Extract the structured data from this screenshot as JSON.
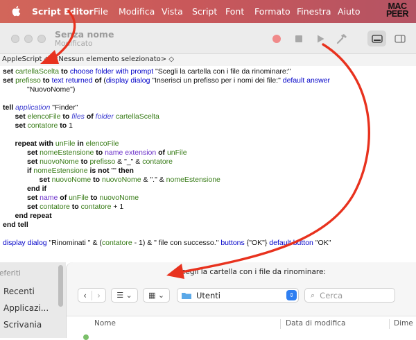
{
  "menubar": {
    "app": "Script Editor",
    "items": [
      "File",
      "Modifica",
      "Vista",
      "Script",
      "Font",
      "Formato",
      "Finestra",
      "Aiuto"
    ],
    "logo_line1": "MAC",
    "logo_line2": "PEER"
  },
  "window": {
    "title": "Senza nome",
    "subtitle": "Modificato"
  },
  "navbar": {
    "language": "AppleScript",
    "selection": "<Nessun elemento selezionato>"
  },
  "code": [
    [
      [
        "kw",
        "set "
      ],
      [
        "var",
        "cartellaScelta"
      ],
      [
        "kw",
        " to "
      ],
      [
        "cmd",
        "choose folder"
      ],
      [
        "cmd",
        " with prompt"
      ],
      [
        "str",
        " \"Scegli la cartella con i file da rinominare:\""
      ]
    ],
    [
      [
        "kw",
        "set "
      ],
      [
        "var",
        "prefisso"
      ],
      [
        "kw",
        " to "
      ],
      [
        "cmd",
        "text returned"
      ],
      [
        "kw",
        " of "
      ],
      [
        "op",
        "("
      ],
      [
        "cmd",
        "display dialog"
      ],
      [
        "str",
        " \"Inserisci un prefisso per i nomi dei file:\" "
      ],
      [
        "cmd",
        "default answer"
      ]
    ],
    [
      [
        "str",
        "            \"NuovoNome\")"
      ]
    ],
    [],
    [
      [
        "kw",
        "tell "
      ],
      [
        "cls",
        "application"
      ],
      [
        "str",
        " \"Finder\""
      ]
    ],
    [
      [
        "op",
        "      "
      ],
      [
        "kw",
        "set "
      ],
      [
        "var",
        "elencoFile"
      ],
      [
        "kw",
        " to "
      ],
      [
        "cls",
        "files"
      ],
      [
        "kw",
        " of "
      ],
      [
        "cls",
        "folder"
      ],
      [
        "var",
        " cartellaScelta"
      ]
    ],
    [
      [
        "op",
        "      "
      ],
      [
        "kw",
        "set "
      ],
      [
        "var",
        "contatore"
      ],
      [
        "kw",
        " to "
      ],
      [
        "op",
        "1"
      ]
    ],
    [],
    [
      [
        "op",
        "      "
      ],
      [
        "kw",
        "repeat with "
      ],
      [
        "var",
        "unFile"
      ],
      [
        "kw",
        " in "
      ],
      [
        "var",
        "elencoFile"
      ]
    ],
    [
      [
        "op",
        "            "
      ],
      [
        "kw",
        "set "
      ],
      [
        "var",
        "nomeEstensione"
      ],
      [
        "kw",
        " to "
      ],
      [
        "prop",
        "name extension"
      ],
      [
        "kw",
        " of "
      ],
      [
        "var",
        "unFile"
      ]
    ],
    [
      [
        "op",
        "            "
      ],
      [
        "kw",
        "set "
      ],
      [
        "var",
        "nuovoNome"
      ],
      [
        "kw",
        " to "
      ],
      [
        "var",
        "prefisso"
      ],
      [
        "op",
        " & \"_\" & "
      ],
      [
        "var",
        "contatore"
      ]
    ],
    [
      [
        "op",
        "            "
      ],
      [
        "kw",
        "if "
      ],
      [
        "var",
        "nomeEstensione"
      ],
      [
        "kw",
        " is not "
      ],
      [
        "op",
        "\"\" "
      ],
      [
        "kw",
        "then"
      ]
    ],
    [
      [
        "op",
        "                  "
      ],
      [
        "kw",
        "set "
      ],
      [
        "var",
        "nuovoNome"
      ],
      [
        "kw",
        " to "
      ],
      [
        "var",
        "nuovoNome"
      ],
      [
        "op",
        " & \".\" & "
      ],
      [
        "var",
        "nomeEstensione"
      ]
    ],
    [
      [
        "op",
        "            "
      ],
      [
        "kw",
        "end if"
      ]
    ],
    [
      [
        "op",
        "            "
      ],
      [
        "kw",
        "set "
      ],
      [
        "prop",
        "name"
      ],
      [
        "kw",
        " of "
      ],
      [
        "var",
        "unFile"
      ],
      [
        "kw",
        " to "
      ],
      [
        "var",
        "nuovoNome"
      ]
    ],
    [
      [
        "op",
        "            "
      ],
      [
        "kw",
        "set "
      ],
      [
        "var",
        "contatore"
      ],
      [
        "kw",
        " to "
      ],
      [
        "var",
        "contatore"
      ],
      [
        "op",
        " + 1"
      ]
    ],
    [
      [
        "op",
        "      "
      ],
      [
        "kw",
        "end repeat"
      ]
    ],
    [
      [
        "kw",
        "end tell"
      ]
    ],
    [],
    [
      [
        "cmd",
        "display dialog"
      ],
      [
        "str",
        " \"Rinominati \" & ("
      ],
      [
        "var",
        "contatore"
      ],
      [
        "op",
        " - 1) & \" file con successo.\" "
      ],
      [
        "cmd",
        "buttons"
      ],
      [
        "op",
        " {\"OK\"} "
      ],
      [
        "cmd",
        "default button"
      ],
      [
        "op",
        " \"OK\""
      ]
    ]
  ],
  "dialog": {
    "prompt": "Scegli la cartella con i file da rinominare:",
    "location": "Utenti",
    "search_placeholder": "Cerca",
    "sidebar_header": "eferiti",
    "sidebar_items": [
      "Recenti",
      "Applicazi...",
      "Scrivania"
    ],
    "columns": [
      "Nome",
      "Data di modifica",
      "Dime"
    ]
  },
  "colors": {
    "keyword": "#0a0a0a",
    "variable": "#357a14",
    "command": "#0000c8",
    "annotation_arrow": "#e8321e"
  }
}
